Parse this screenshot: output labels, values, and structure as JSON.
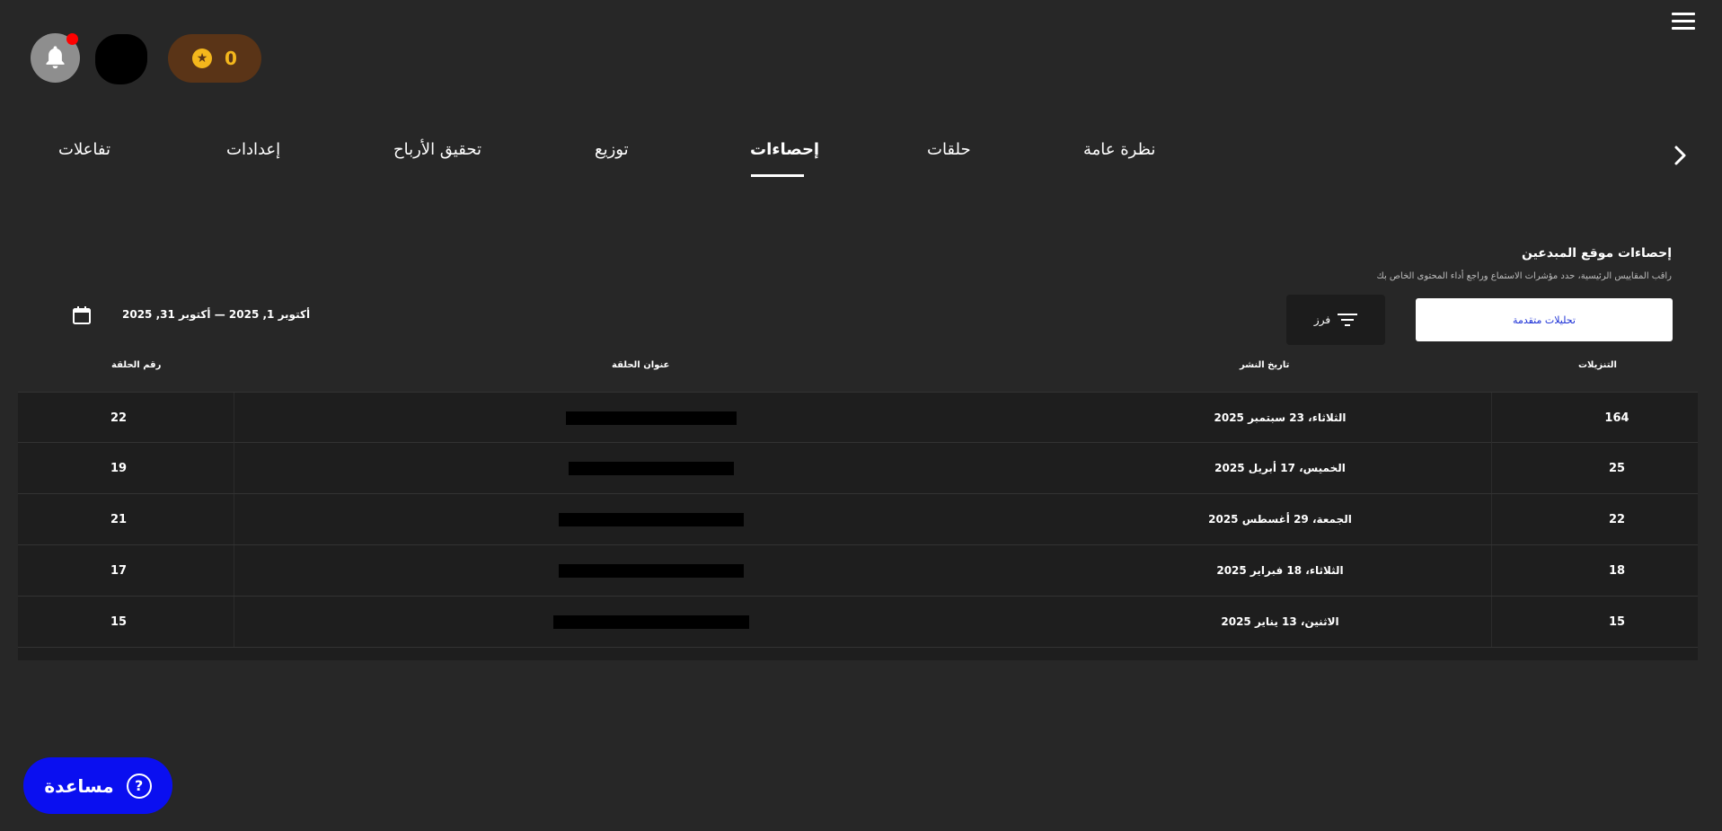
{
  "colors": {
    "background": "#272727",
    "row_background": "#1e1e1e",
    "points_badge": "#5a3417",
    "points_accent": "#f4b71c",
    "notification_dot": "#ff0000",
    "help_button": "#0a0ff0",
    "advanced_text": "#1a2fd6"
  },
  "header": {
    "menu_icon": "hamburger-icon",
    "notification_icon": "bell-icon",
    "points_icon": "star-icon",
    "points_value": "0"
  },
  "tabs": [
    {
      "label": "تفاعلات"
    },
    {
      "label": "إعدادات"
    },
    {
      "label": "تحقيق الأرباح"
    },
    {
      "label": "توزيع"
    },
    {
      "label": "إحصاءات",
      "active": true
    },
    {
      "label": "حلقات"
    },
    {
      "label": "نظرة عامة"
    }
  ],
  "section": {
    "title": "إحصاءات موقع المبدعين",
    "subtitle": "راقب المقاييس الرئيسية، حدد مؤشرات الاستماع وراجع أداء المحتوى الخاص بك",
    "advanced_button": "تحليلات متقدمة",
    "sort_button": "فرز",
    "date_range": "أكتوبر 1, 2025 — أكتوبر 31, 2025"
  },
  "table": {
    "headers": {
      "downloads": "التنزيلات",
      "publish_date": "تاريخ النشر",
      "episode_title": "عنوان الحلقة",
      "episode_number": "رقم الحلقة"
    },
    "rows": [
      {
        "downloads": "164",
        "publish_date": "الثلاثاء، 23 سبتمبر 2025",
        "episode_number": "22"
      },
      {
        "downloads": "25",
        "publish_date": "الخميس، 17 أبريل 2025",
        "episode_number": "19"
      },
      {
        "downloads": "22",
        "publish_date": "الجمعة، 29 أغسطس 2025",
        "episode_number": "21"
      },
      {
        "downloads": "18",
        "publish_date": "الثلاثاء، 18 فبراير 2025",
        "episode_number": "17"
      },
      {
        "downloads": "15",
        "publish_date": "الاثنين، 13 يناير 2025",
        "episode_number": "15"
      }
    ]
  },
  "help": {
    "label": "مساعدة",
    "icon": "question-icon"
  }
}
